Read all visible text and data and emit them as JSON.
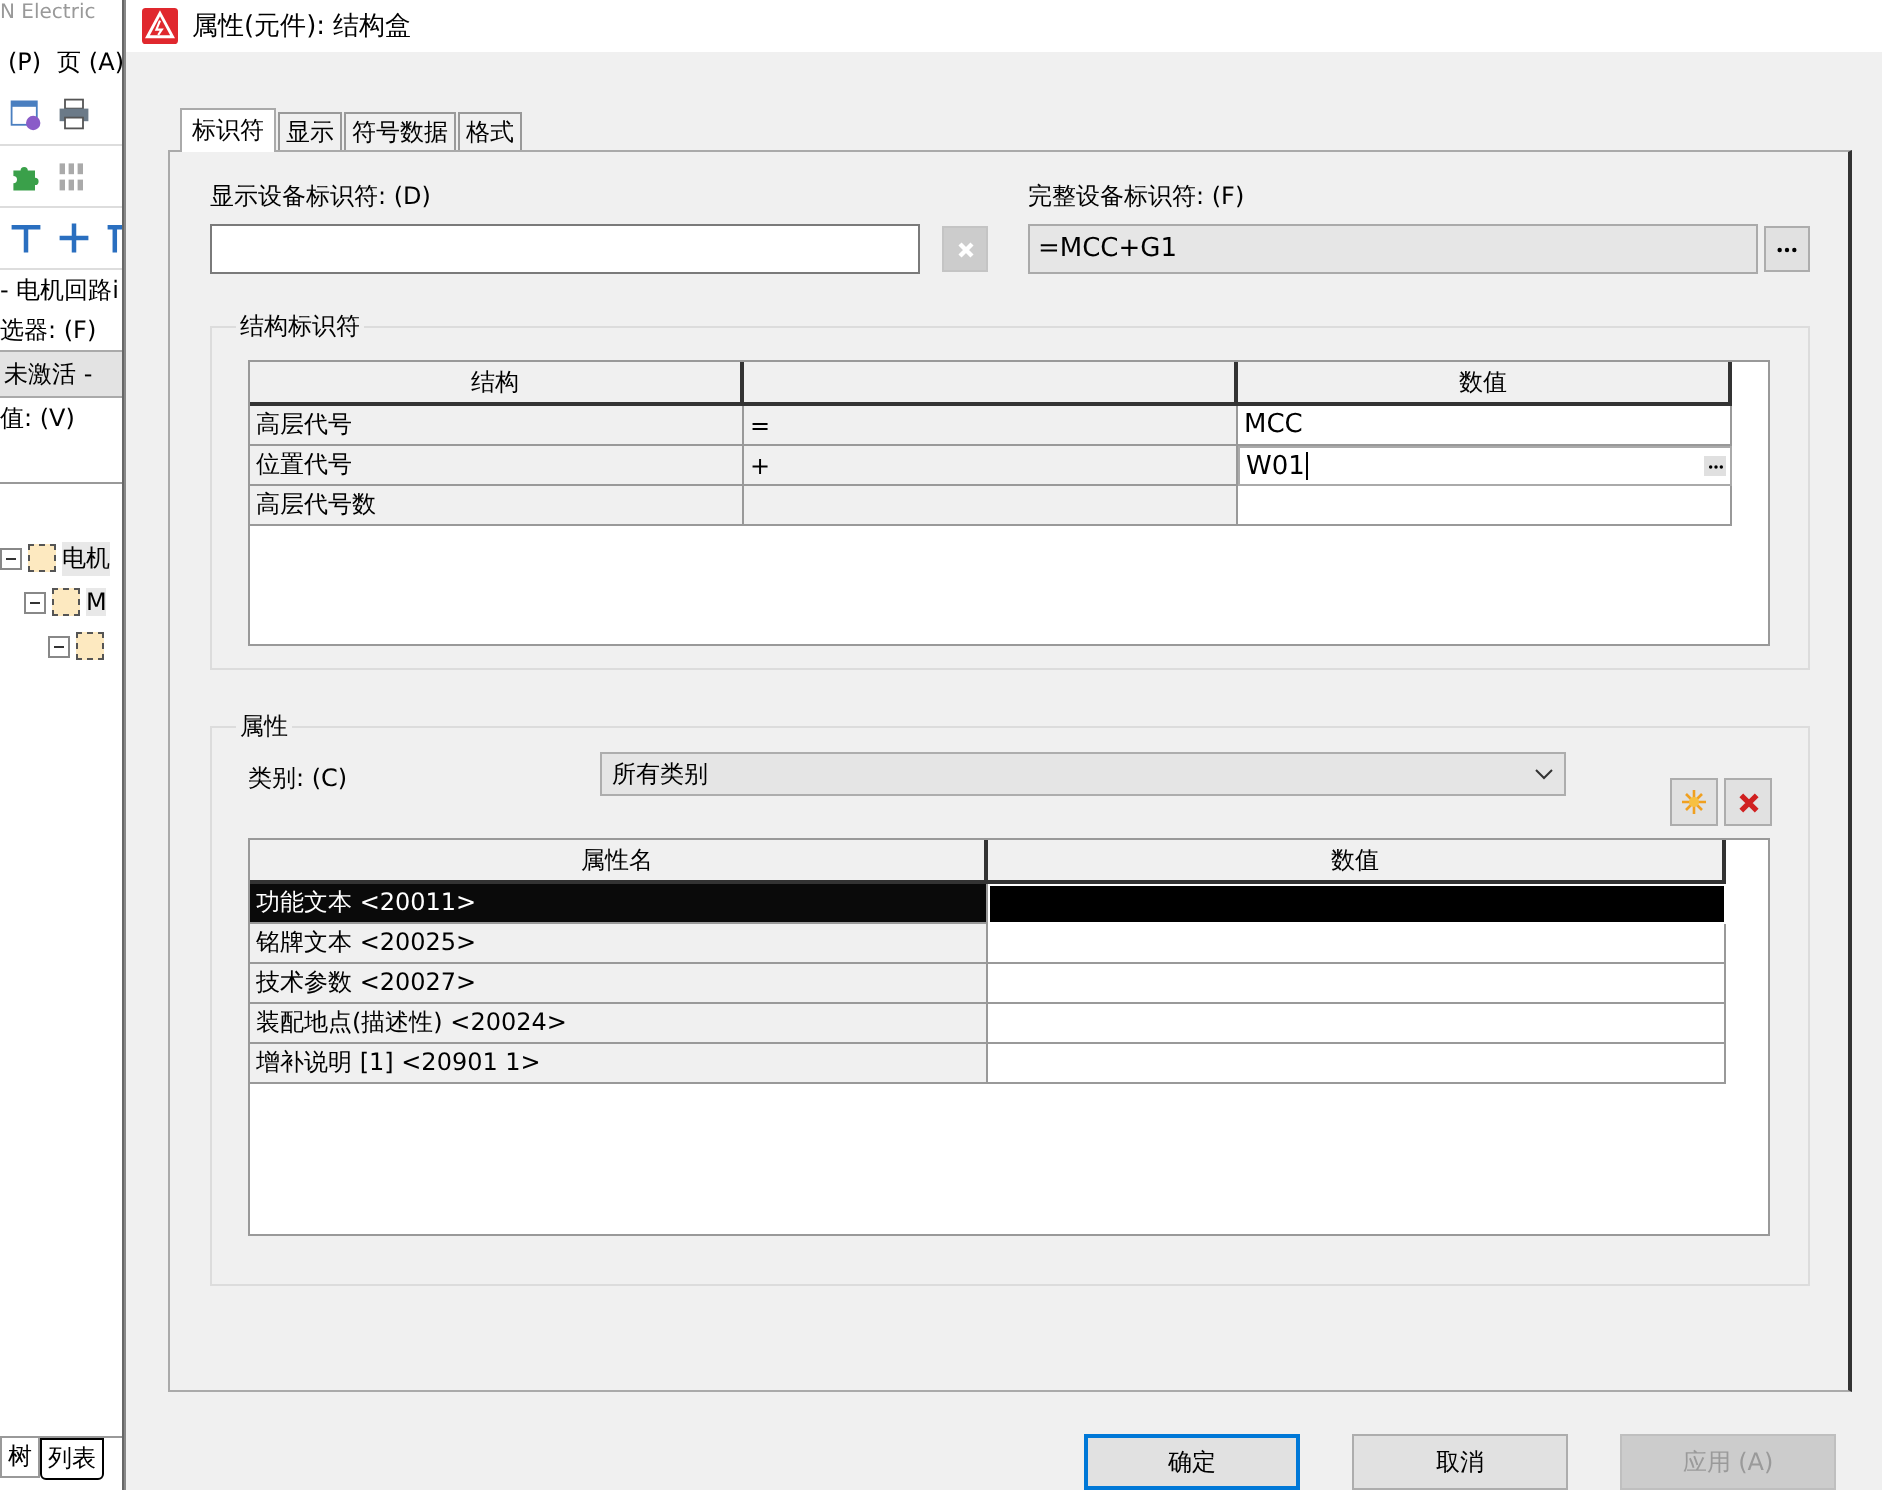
{
  "background_window": {
    "title": "N Electric",
    "menu": [
      "(P)",
      "页 (A)"
    ],
    "page_title": "- 电机回路i",
    "filter_label": "选器: (F)",
    "filter_value": "未激活 -",
    "value_label": "值: (V)",
    "tree": [
      {
        "label": "电机",
        "expanded": true,
        "children": [
          {
            "label": "M",
            "expanded": true,
            "children": [
              {
                "expanded": true
              }
            ]
          }
        ]
      }
    ],
    "tabs": [
      {
        "label": "树",
        "selected": false
      },
      {
        "label": "列表",
        "selected": true
      }
    ]
  },
  "window": {
    "title": "属性(元件): 结构盒"
  },
  "tabs": [
    {
      "label": "标识符",
      "selected": true
    },
    {
      "label": "显示",
      "selected": false
    },
    {
      "label": "符号数据",
      "selected": false
    },
    {
      "label": "格式",
      "selected": false
    }
  ],
  "display_identifier": {
    "label": "显示设备标识符: (D)"
  },
  "full_identifier": {
    "label": "完整设备标识符: (F)",
    "value": "=MCC+G1"
  },
  "structure": {
    "title": "结构标识符",
    "columns": [
      "结构",
      "",
      "数值"
    ],
    "rows": [
      {
        "name": "高层代号",
        "prefix": "=",
        "value": "MCC",
        "editing": false
      },
      {
        "name": "位置代号",
        "prefix": "+",
        "value": "W01",
        "editing": true
      },
      {
        "name": "高层代号数",
        "prefix": "",
        "value": "",
        "editing": false
      }
    ]
  },
  "properties": {
    "title": "属性",
    "category_label": "类别: (C)",
    "category": "所有类别",
    "columns": [
      "属性名",
      "数值"
    ],
    "rows": [
      {
        "name": "功能文本 <20011>",
        "value": "",
        "selected": true
      },
      {
        "name": "铭牌文本 <20025>",
        "value": "",
        "selected": false
      },
      {
        "name": "技术参数 <20027>",
        "value": "",
        "selected": false
      },
      {
        "name": "装配地点(描述性) <20024>",
        "value": "",
        "selected": false
      },
      {
        "name": "增补说明 [1] <20901 1>",
        "value": "",
        "selected": false
      }
    ]
  },
  "buttons": [
    {
      "label": "确定",
      "disabled": false,
      "default": true
    },
    {
      "label": "取消",
      "disabled": false,
      "default": false
    },
    {
      "label": "应用 (A)",
      "disabled": true,
      "default": false
    }
  ]
}
